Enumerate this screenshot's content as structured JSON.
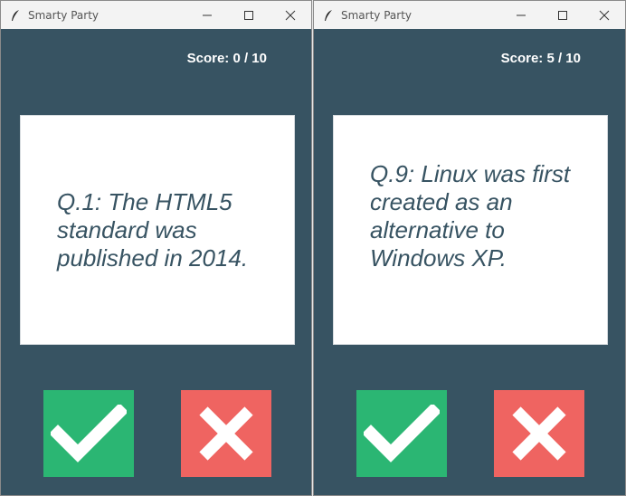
{
  "windows": [
    {
      "title": "Smarty Party",
      "score_text": "Score: 0 / 10",
      "question_text": "Q.1: The HTML5 standard was published in 2014.",
      "question_lines": [
        "Q.1: The HTML5",
        "standard was",
        "published in 2014."
      ]
    },
    {
      "title": "Smarty Party",
      "score_text": "Score: 5 / 10",
      "question_text": "Q.9: Linux was first created as an alternative to Windows XP.",
      "question_lines": [
        "Q.9: Linux was first",
        "created as an",
        "alternative to",
        "Windows XP."
      ]
    }
  ],
  "colors": {
    "background": "#375362",
    "card": "#ffffff",
    "true_button": "#2bb673",
    "false_button": "#ef6461",
    "question_text": "#375362"
  },
  "icons": {
    "app": "feather-icon",
    "minimize": "minimize-icon",
    "maximize": "maximize-icon",
    "close": "close-icon",
    "true": "checkmark-icon",
    "false": "cross-icon"
  }
}
